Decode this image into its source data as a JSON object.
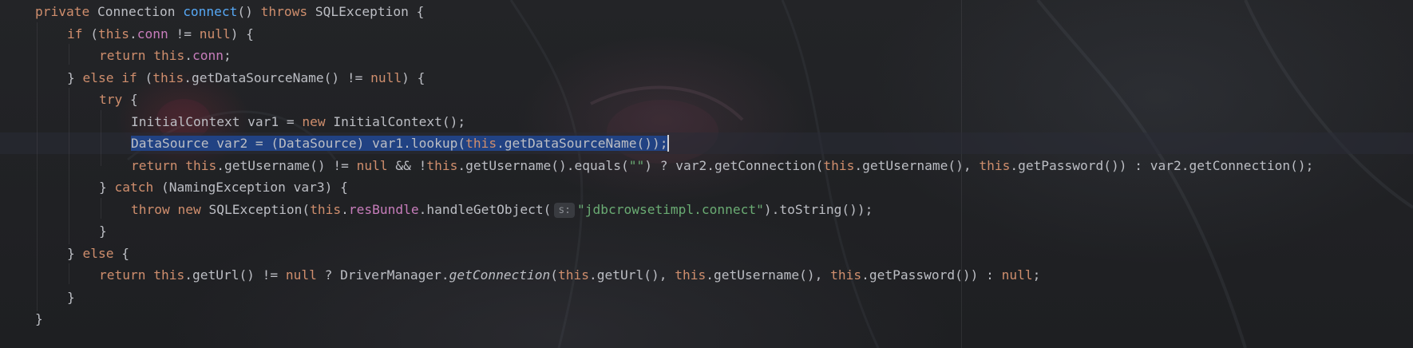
{
  "editor": {
    "language": "java",
    "theme": {
      "background": "#1f2124",
      "text": "#bcbec4",
      "keyword": "#cf8e6d",
      "field": "#c77dbb",
      "method_declaration": "#56a8f5",
      "string": "#6aab73",
      "selection": "#214283",
      "param_hint_bg": "#393b40"
    },
    "lines": [
      {
        "indent": 0,
        "tokens": [
          {
            "t": "private",
            "c": "kw"
          },
          {
            "t": " Connection "
          },
          {
            "t": "connect",
            "c": "fn"
          },
          {
            "t": "() "
          },
          {
            "t": "throws",
            "c": "kw"
          },
          {
            "t": " SQLException {"
          }
        ]
      },
      {
        "indent": 1,
        "tokens": [
          {
            "t": "if",
            "c": "kw"
          },
          {
            "t": " ("
          },
          {
            "t": "this",
            "c": "kw"
          },
          {
            "t": "."
          },
          {
            "t": "conn",
            "c": "fld"
          },
          {
            "t": " != "
          },
          {
            "t": "null",
            "c": "kw"
          },
          {
            "t": ") {"
          }
        ]
      },
      {
        "indent": 2,
        "tokens": [
          {
            "t": "return",
            "c": "kw"
          },
          {
            "t": " "
          },
          {
            "t": "this",
            "c": "kw"
          },
          {
            "t": "."
          },
          {
            "t": "conn",
            "c": "fld"
          },
          {
            "t": ";"
          }
        ]
      },
      {
        "indent": 1,
        "tokens": [
          {
            "t": "} "
          },
          {
            "t": "else if",
            "c": "kw"
          },
          {
            "t": " ("
          },
          {
            "t": "this",
            "c": "kw"
          },
          {
            "t": ".getDataSourceName() != "
          },
          {
            "t": "null",
            "c": "kw"
          },
          {
            "t": ") {"
          }
        ]
      },
      {
        "indent": 2,
        "tokens": [
          {
            "t": "try",
            "c": "kw"
          },
          {
            "t": " {"
          }
        ]
      },
      {
        "indent": 3,
        "tokens": [
          {
            "t": "InitialContext var1 = "
          },
          {
            "t": "new",
            "c": "kw"
          },
          {
            "t": " InitialContext();"
          }
        ]
      },
      {
        "indent": 3,
        "selected": true,
        "caret": true,
        "tokens": [
          {
            "t": "DataSource var2 = (DataSource) var1.lookup("
          },
          {
            "t": "this",
            "c": "kw"
          },
          {
            "t": ".getDataSourceName());"
          }
        ]
      },
      {
        "indent": 3,
        "tokens": [
          {
            "t": "return",
            "c": "kw"
          },
          {
            "t": " "
          },
          {
            "t": "this",
            "c": "kw"
          },
          {
            "t": ".getUsername() != "
          },
          {
            "t": "null",
            "c": "kw"
          },
          {
            "t": " && !"
          },
          {
            "t": "this",
            "c": "kw"
          },
          {
            "t": ".getUsername().equals("
          },
          {
            "t": "\"\"",
            "c": "str"
          },
          {
            "t": ") ? var2.getConnection("
          },
          {
            "t": "this",
            "c": "kw"
          },
          {
            "t": ".getUsername(), "
          },
          {
            "t": "this",
            "c": "kw"
          },
          {
            "t": ".getPassword()) : var2.getConnection();"
          }
        ]
      },
      {
        "indent": 2,
        "tokens": [
          {
            "t": "} "
          },
          {
            "t": "catch",
            "c": "kw"
          },
          {
            "t": " (NamingException var3) {"
          }
        ]
      },
      {
        "indent": 3,
        "tokens": [
          {
            "t": "throw",
            "c": "kw"
          },
          {
            "t": " "
          },
          {
            "t": "new",
            "c": "kw"
          },
          {
            "t": " SQLException("
          },
          {
            "t": "this",
            "c": "kw"
          },
          {
            "t": "."
          },
          {
            "t": "resBundle",
            "c": "fld"
          },
          {
            "t": ".handleGetObject("
          },
          {
            "t": "s:",
            "c": "hint"
          },
          {
            "t": "\"jdbcrowsetimpl.connect\"",
            "c": "str"
          },
          {
            "t": ").toString());"
          }
        ]
      },
      {
        "indent": 2,
        "tokens": [
          {
            "t": "}"
          }
        ]
      },
      {
        "indent": 1,
        "tokens": [
          {
            "t": "} "
          },
          {
            "t": "else",
            "c": "kw"
          },
          {
            "t": " {"
          }
        ]
      },
      {
        "indent": 2,
        "tokens": [
          {
            "t": "return",
            "c": "kw"
          },
          {
            "t": " "
          },
          {
            "t": "this",
            "c": "kw"
          },
          {
            "t": ".getUrl() != "
          },
          {
            "t": "null",
            "c": "kw"
          },
          {
            "t": " ? DriverManager."
          },
          {
            "t": "getConnection",
            "c": "static"
          },
          {
            "t": "("
          },
          {
            "t": "this",
            "c": "kw"
          },
          {
            "t": ".getUrl(), "
          },
          {
            "t": "this",
            "c": "kw"
          },
          {
            "t": ".getUsername(), "
          },
          {
            "t": "this",
            "c": "kw"
          },
          {
            "t": ".getPassword()) : "
          },
          {
            "t": "null",
            "c": "kw"
          },
          {
            "t": ";"
          }
        ]
      },
      {
        "indent": 1,
        "tokens": [
          {
            "t": "}"
          }
        ]
      },
      {
        "indent": 0,
        "tokens": [
          {
            "t": "}"
          }
        ]
      }
    ]
  }
}
